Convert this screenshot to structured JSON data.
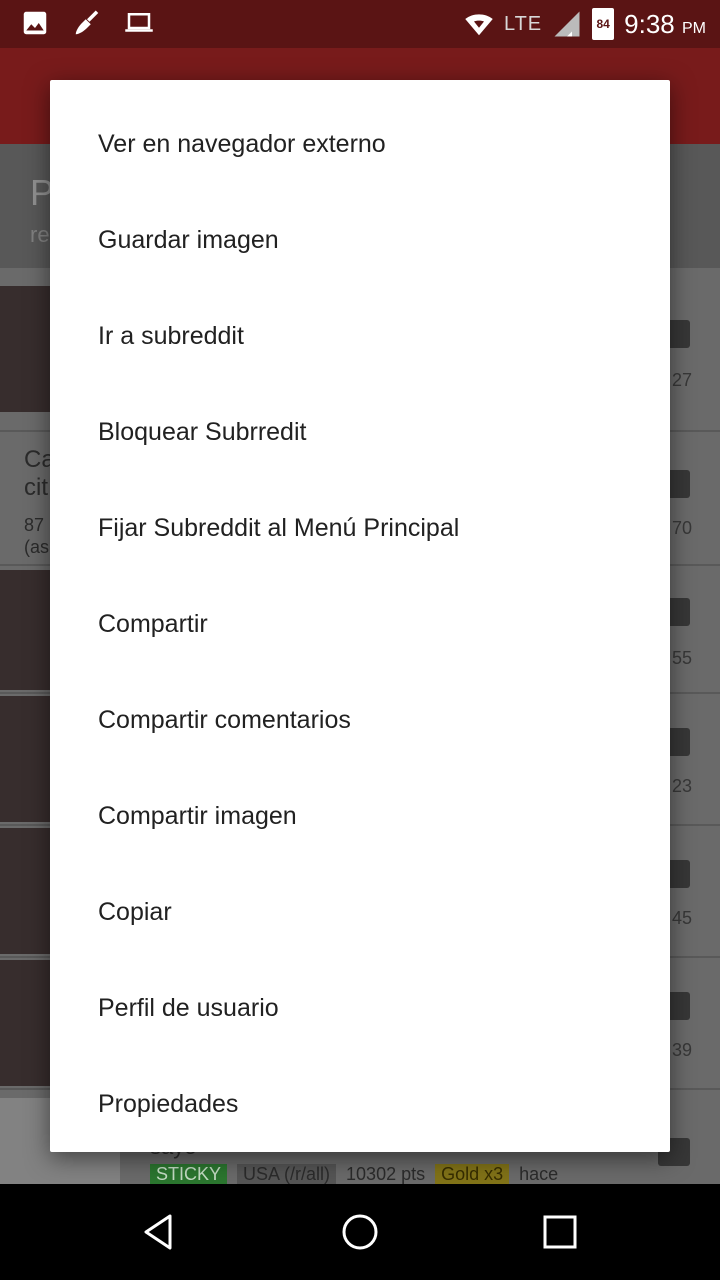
{
  "status_bar": {
    "left_icons": [
      "image-icon",
      "broom-icon",
      "laptop-icon"
    ],
    "network": "LTE",
    "battery": "84",
    "time": "9:38",
    "ampm": "PM"
  },
  "background_app": {
    "header_title": "P",
    "header_sub": "re",
    "rows": [
      {
        "count": "27"
      },
      {
        "title": "Ca",
        "title2": "cit",
        "meta": "87",
        "meta2": "(as",
        "count": "70"
      },
      {
        "count": "55"
      },
      {
        "count": "23"
      },
      {
        "count": "45"
      },
      {
        "count": "39"
      }
    ],
    "bottom_title": "saye",
    "bottom_badges": {
      "sticky": "STICKY",
      "subreddit": "USA (/r/all)",
      "points": "10302 pts",
      "gold": "Gold x3",
      "time": "hace"
    }
  },
  "menu": {
    "items": [
      "Ver en navegador externo",
      "Guardar imagen",
      "Ir a subreddit",
      "Bloquear Subrredit",
      "Fijar Subreddit al Menú Principal",
      "Compartir",
      "Compartir comentarios",
      "Compartir imagen",
      "Copiar",
      "Perfil de usuario",
      "Propiedades"
    ]
  },
  "nav_bar": {
    "buttons": [
      "back-icon",
      "home-icon",
      "recents-icon"
    ]
  }
}
